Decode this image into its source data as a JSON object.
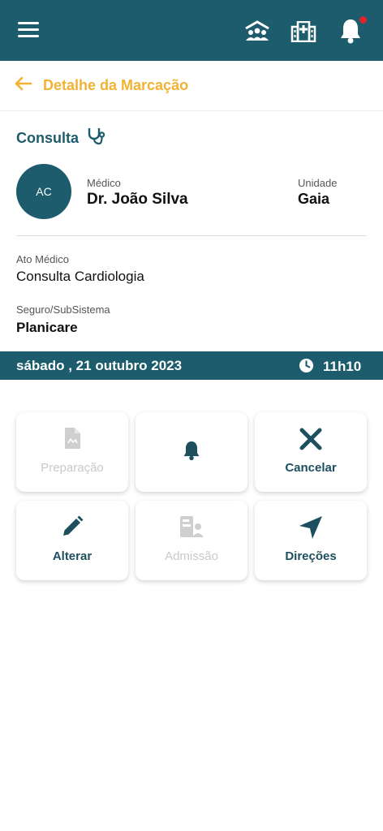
{
  "topbar": {
    "icons": [
      "menu-icon",
      "community-icon",
      "hospital-icon",
      "bell-icon"
    ],
    "has_notification": true,
    "bg_color": "#1d5c6c"
  },
  "header": {
    "title": "Detalhe da Marcação",
    "back_icon": "arrow-left-icon",
    "accent_color": "#f2b233"
  },
  "appointment": {
    "type": "Consulta",
    "type_icon": "stethoscope-icon",
    "avatar_initials": "AC",
    "doctor_label": "Médico",
    "doctor_name": "Dr. João Silva",
    "unit_label": "Unidade",
    "unit_name": "Gaia",
    "act_label": "Ato Médico",
    "act_value": "Consulta Cardiologia",
    "insurance_label": "Seguro/SubSistema",
    "insurance_value": "Planicare",
    "date": "sábado , 21 outubro 2023",
    "time": "11h10"
  },
  "actions": [
    {
      "label": "Preparação",
      "icon": "document-icon",
      "enabled": false
    },
    {
      "label": "",
      "icon": "bell-icon",
      "enabled": true
    },
    {
      "label": "Cancelar",
      "icon": "close-icon",
      "enabled": true
    },
    {
      "label": "Alterar",
      "icon": "pencil-icon",
      "enabled": true
    },
    {
      "label": "Admissão",
      "icon": "id-card-icon",
      "enabled": false
    },
    {
      "label": "Direções",
      "icon": "navigation-icon",
      "enabled": true
    }
  ]
}
